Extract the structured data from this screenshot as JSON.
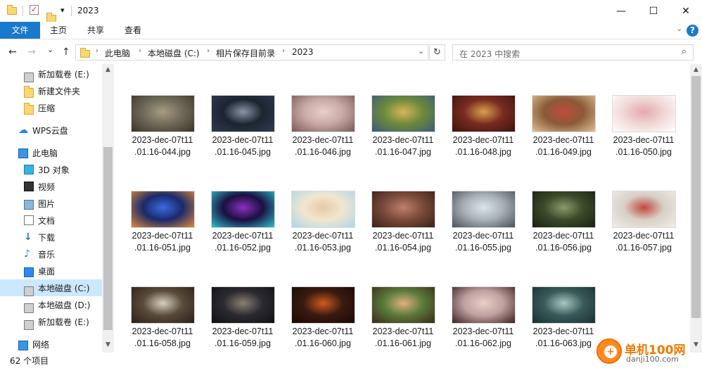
{
  "window": {
    "title": "2023",
    "minimize_glyph": "—",
    "maximize_glyph": "☐",
    "close_glyph": "✕",
    "qa_dropdown": "▾"
  },
  "ribbon": {
    "file": "文件",
    "home": "主页",
    "share": "共享",
    "view": "查看",
    "collapse_glyph": "⌄",
    "help_glyph": "?"
  },
  "nav": {
    "back": "←",
    "forward": "→",
    "recent": "⌄",
    "up": "↑",
    "address_dropdown": "⌄",
    "refresh": "↻",
    "breadcrumb": [
      "此电脑",
      "本地磁盘 (C:)",
      "相片保存目前录",
      "2023"
    ],
    "breadcrumb_sep": "›",
    "search_placeholder": "在 2023 中搜索",
    "search_glyph": "⌕"
  },
  "sidebar": {
    "items": [
      {
        "label": "新加载卷 (E:)",
        "icon": "drive-icon"
      },
      {
        "label": "新建文件夹",
        "icon": "folder-icon"
      },
      {
        "label": "压缩",
        "icon": "folder-icon"
      },
      {
        "label": "WPS云盘",
        "icon": "cloud-icon"
      },
      {
        "label": "此电脑",
        "icon": "pc-icon"
      },
      {
        "label": "3D 对象",
        "icon": "cube-icon"
      },
      {
        "label": "视频",
        "icon": "video-icon"
      },
      {
        "label": "图片",
        "icon": "picture-icon"
      },
      {
        "label": "文档",
        "icon": "document-icon"
      },
      {
        "label": "下载",
        "icon": "download-icon"
      },
      {
        "label": "音乐",
        "icon": "music-icon"
      },
      {
        "label": "桌面",
        "icon": "desktop-icon"
      },
      {
        "label": "本地磁盘 (C:)",
        "icon": "drive-icon"
      },
      {
        "label": "本地磁盘 (D:)",
        "icon": "drive-icon"
      },
      {
        "label": "新加载卷 (E:)",
        "icon": "drive-icon"
      },
      {
        "label": "网络",
        "icon": "network-icon"
      }
    ],
    "selected_label": "本地磁盘 (C:)"
  },
  "files": [
    {
      "name": "2023-dec-07t11.01.16-044.jpg",
      "colors": [
        "#6f6a5a",
        "#a89c82",
        "#3b3528"
      ]
    },
    {
      "name": "2023-dec-07t11.01.16-045.jpg",
      "colors": [
        "#1c2430",
        "#8a94a6",
        "#2f3c52"
      ]
    },
    {
      "name": "2023-dec-07t11.01.16-046.jpg",
      "colors": [
        "#c9a9a6",
        "#e6cfcb",
        "#7a5a55"
      ]
    },
    {
      "name": "2023-dec-07t11.01.16-047.jpg",
      "colors": [
        "#6c8a3a",
        "#d9b45a",
        "#3b5a7a"
      ]
    },
    {
      "name": "2023-dec-07t11.01.16-048.jpg",
      "colors": [
        "#7a2a20",
        "#d8a04a",
        "#3a1510"
      ]
    },
    {
      "name": "2023-dec-07t11.01.16-049.jpg",
      "colors": [
        "#8a5a3a",
        "#c04a3a",
        "#e0c090"
      ]
    },
    {
      "name": "2023-dec-07t11.01.16-050.jpg",
      "colors": [
        "#f0d6d4",
        "#e6a8b0",
        "#ffffff"
      ]
    },
    {
      "name": "2023-dec-07t11.01.16-051.jpg",
      "colors": [
        "#1a2a6a",
        "#3a6ae0",
        "#e08a3a"
      ]
    },
    {
      "name": "2023-dec-07t11.01.16-052.jpg",
      "colors": [
        "#1a1040",
        "#8a30c0",
        "#30c0d0"
      ]
    },
    {
      "name": "2023-dec-07t11.01.16-053.jpg",
      "colors": [
        "#f2e6d0",
        "#e8c8a8",
        "#a8d8e8"
      ]
    },
    {
      "name": "2023-dec-07t11.01.16-054.jpg",
      "colors": [
        "#7a4a3a",
        "#c08070",
        "#3a2018"
      ]
    },
    {
      "name": "2023-dec-07t11.01.16-055.jpg",
      "colors": [
        "#a8b0b8",
        "#dfe4e8",
        "#4a5058"
      ]
    },
    {
      "name": "2023-dec-07t11.01.16-056.jpg",
      "colors": [
        "#3a4a2a",
        "#8a9a6a",
        "#1a2010"
      ]
    },
    {
      "name": "2023-dec-07t11.01.16-057.jpg",
      "colors": [
        "#d8d0c8",
        "#c04a3a",
        "#f0ece8"
      ]
    },
    {
      "name": "2023-dec-07t11.01.16-058.jpg",
      "colors": [
        "#5a4a3a",
        "#d8d0c0",
        "#2a2018"
      ]
    },
    {
      "name": "2023-dec-07t11.01.16-059.jpg",
      "colors": [
        "#2a2a30",
        "#8a8070",
        "#101014"
      ]
    },
    {
      "name": "2023-dec-07t11.01.16-060.jpg",
      "colors": [
        "#3a1a10",
        "#d05a20",
        "#1a0a05"
      ]
    },
    {
      "name": "2023-dec-07t11.01.16-061.jpg",
      "colors": [
        "#5a7a3a",
        "#e0b080",
        "#3a2a1a"
      ]
    },
    {
      "name": "2023-dec-07t11.01.16-062.jpg",
      "colors": [
        "#c0a0a0",
        "#e8d0c8",
        "#3a2020"
      ]
    },
    {
      "name": "2023-dec-07t11.01.16-063.jpg",
      "colors": [
        "#3a5a5a",
        "#a8c8c0",
        "#1a3030"
      ]
    }
  ],
  "status": {
    "count": "62 个项目"
  },
  "watermark": {
    "brand": "单机100网",
    "url": "danji100.com",
    "logo_glyph": "+"
  },
  "colors": {
    "accent": "#1979ca",
    "selection": "#cce8ff",
    "watermark": "#f07a00"
  }
}
